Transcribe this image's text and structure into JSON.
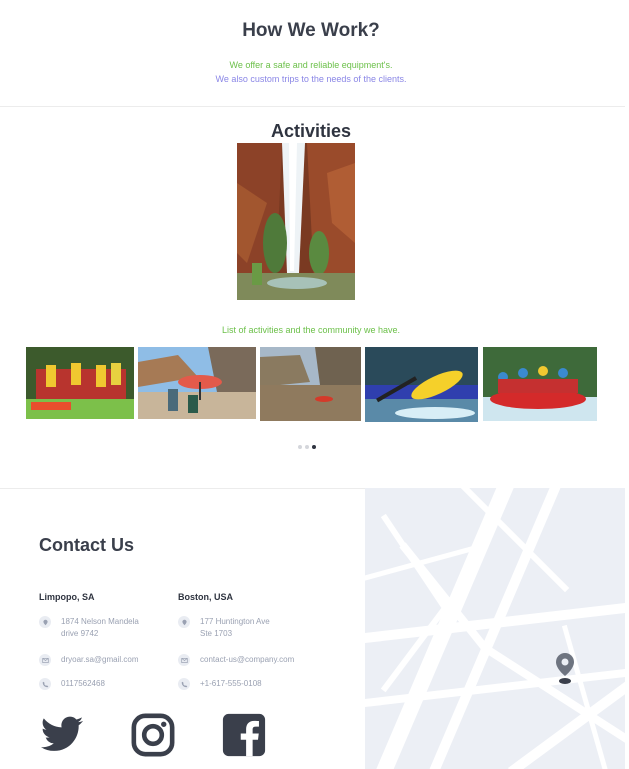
{
  "how": {
    "title": "How We Work?",
    "line1": "We offer a safe and reliable equipment's.",
    "line2": "We also custom trips to the needs of the clients."
  },
  "activities": {
    "title": "Activities",
    "caption": "List of activities and the community we have.",
    "thumbnails": [
      "group-photo",
      "umbrella-beach",
      "river-canyon",
      "kayak-paddle",
      "raft-team"
    ],
    "carousel": {
      "pages": 3,
      "active_page": 3
    }
  },
  "contact": {
    "title": "Contact Us",
    "offices": [
      {
        "name": "Limpopo, SA",
        "address_l1": "1874 Nelson Mandela",
        "address_l2": "drive 9742",
        "email": "dryoar.sa@gmail.com",
        "phone": "0117562468"
      },
      {
        "name": "Boston, USA",
        "address_l1": "177 Huntington Ave",
        "address_l2": "Ste 1703",
        "email": "contact-us@company.com",
        "phone": "+1-617-555-0108"
      }
    ]
  },
  "social": [
    "twitter-icon",
    "instagram-icon",
    "facebook-icon"
  ],
  "colors": {
    "green": "#6cc04a",
    "purple": "#8a86e6",
    "dark": "#3a3f4b",
    "muted": "#9aa1b2",
    "map_bg": "#eceff5"
  }
}
